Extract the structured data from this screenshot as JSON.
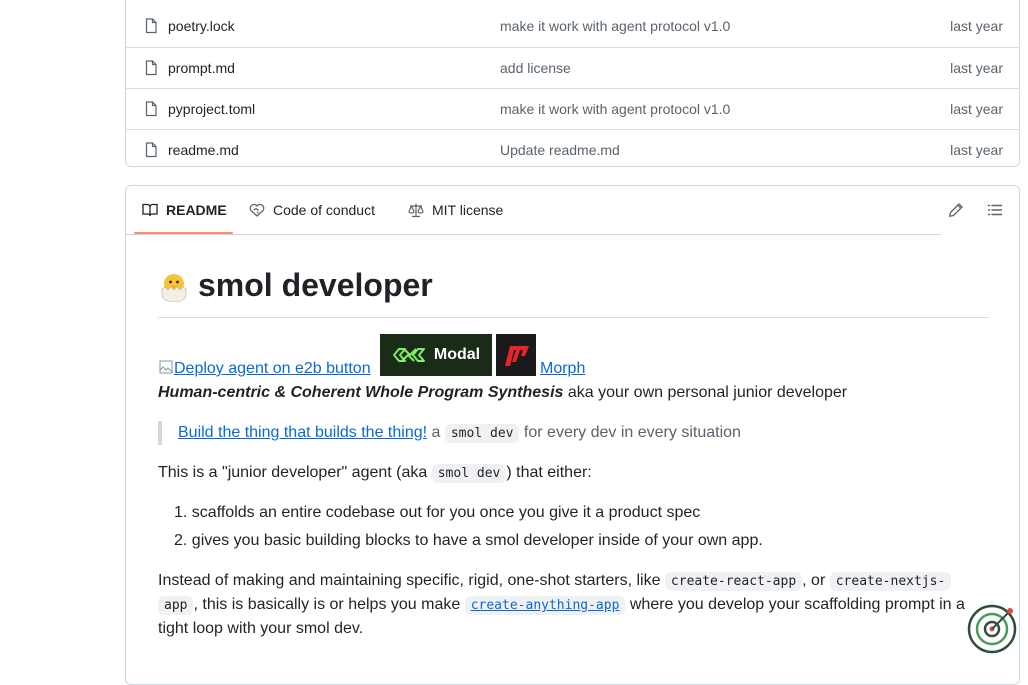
{
  "files": [
    {
      "name": "poetry.lock",
      "message": "make it work with agent protocol v1.0",
      "date": "last year"
    },
    {
      "name": "prompt.md",
      "message": "add license",
      "date": "last year"
    },
    {
      "name": "pyproject.toml",
      "message": "make it work with agent protocol v1.0",
      "date": "last year"
    },
    {
      "name": "readme.md",
      "message": "Update readme.md",
      "date": "last year"
    }
  ],
  "readme_tabs": {
    "readme": "README",
    "conduct": "Code of conduct",
    "license": "MIT license"
  },
  "readme": {
    "title": "smol developer",
    "deploy_alt": "Deploy agent on e2b button",
    "modal_badge": "Modal",
    "morph_link": "Morph",
    "tagline_em": "Human-centric & Coherent Whole Program Synthesis",
    "tagline_rest": " aka your own personal junior developer",
    "quote_link": "Build the thing that builds the thing!",
    "quote_a": " a ",
    "quote_code": "smol dev",
    "quote_rest": " for every dev in every situation",
    "para1_a": "This is a \"junior developer\" agent (aka ",
    "para1_code": "smol dev",
    "para1_b": ") that either:",
    "list": [
      "1. scaffolds an entire codebase out for you once you give it a product spec",
      "2. gives you basic building blocks to have a smol developer inside of your own app."
    ],
    "para2_l1_a": "Instead of making and maintaining specific, rigid, one-shot starters, like ",
    "para2_code1": "create-react-app",
    "para2_l1_b": ", or ",
    "para2_code2a": "create-nextjs-",
    "para2_code2b": "app",
    "para2_l2_a": ", this is basically is or helps you make ",
    "para2_link": "create-anything-app",
    "para2_l2_b": " where you develop your scaffolding prompt in a",
    "para2_l3": "tight loop with your smol dev."
  }
}
